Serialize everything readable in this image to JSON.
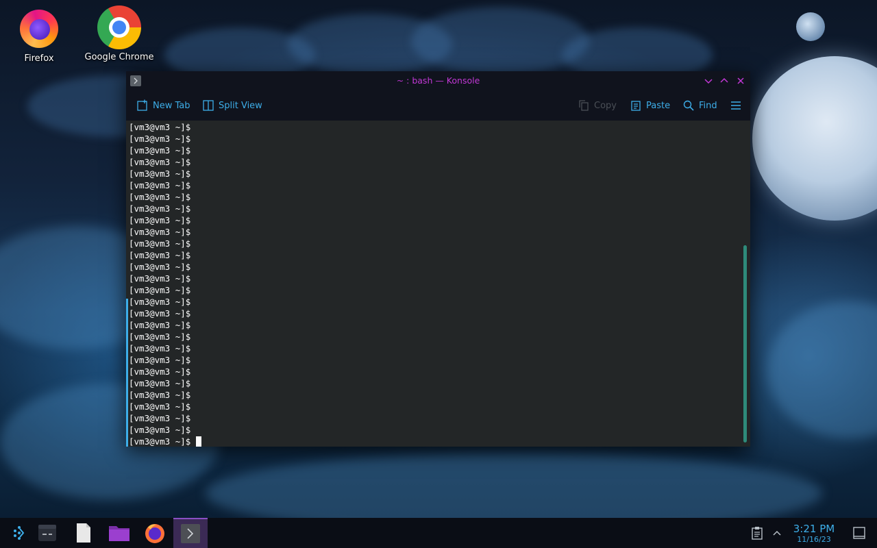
{
  "desktop": {
    "icons": [
      {
        "label": "Firefox",
        "icon": "firefox-icon"
      },
      {
        "label": "Google Chrome",
        "icon": "chrome-icon"
      }
    ]
  },
  "window": {
    "title": "~ : bash — Konsole",
    "title_color": "#c238d6",
    "accent": "#3daee9",
    "toolbar": {
      "new_tab": "New Tab",
      "split_view": "Split View",
      "copy": "Copy",
      "paste": "Paste",
      "find": "Find"
    },
    "terminal": {
      "prompt": "[vm3@vm3 ~]$",
      "lines": [
        "[vm3@vm3 ~]$",
        "[vm3@vm3 ~]$",
        "[vm3@vm3 ~]$",
        "[vm3@vm3 ~]$",
        "[vm3@vm3 ~]$",
        "[vm3@vm3 ~]$",
        "[vm3@vm3 ~]$",
        "[vm3@vm3 ~]$",
        "[vm3@vm3 ~]$",
        "[vm3@vm3 ~]$",
        "[vm3@vm3 ~]$",
        "[vm3@vm3 ~]$",
        "[vm3@vm3 ~]$",
        "[vm3@vm3 ~]$",
        "[vm3@vm3 ~]$",
        "[vm3@vm3 ~]$",
        "[vm3@vm3 ~]$",
        "[vm3@vm3 ~]$",
        "[vm3@vm3 ~]$",
        "[vm3@vm3 ~]$",
        "[vm3@vm3 ~]$",
        "[vm3@vm3 ~]$",
        "[vm3@vm3 ~]$",
        "[vm3@vm3 ~]$",
        "[vm3@vm3 ~]$",
        "[vm3@vm3 ~]$",
        "[vm3@vm3 ~]$"
      ],
      "current_prompt": "[vm3@vm3 ~]$"
    }
  },
  "taskbar": {
    "items": [
      {
        "icon": "app-launcher-icon"
      },
      {
        "icon": "system-settings-icon"
      },
      {
        "icon": "text-editor-icon"
      },
      {
        "icon": "folder-icon"
      },
      {
        "icon": "firefox-icon"
      },
      {
        "icon": "konsole-icon",
        "active": true
      }
    ],
    "tray": {
      "clipboard_icon": "clipboard-icon",
      "expand_icon": "chevron-up-icon",
      "show_desktop_icon": "show-desktop-icon"
    },
    "clock": {
      "time": "3:21 PM",
      "date": "11/16/23"
    }
  }
}
